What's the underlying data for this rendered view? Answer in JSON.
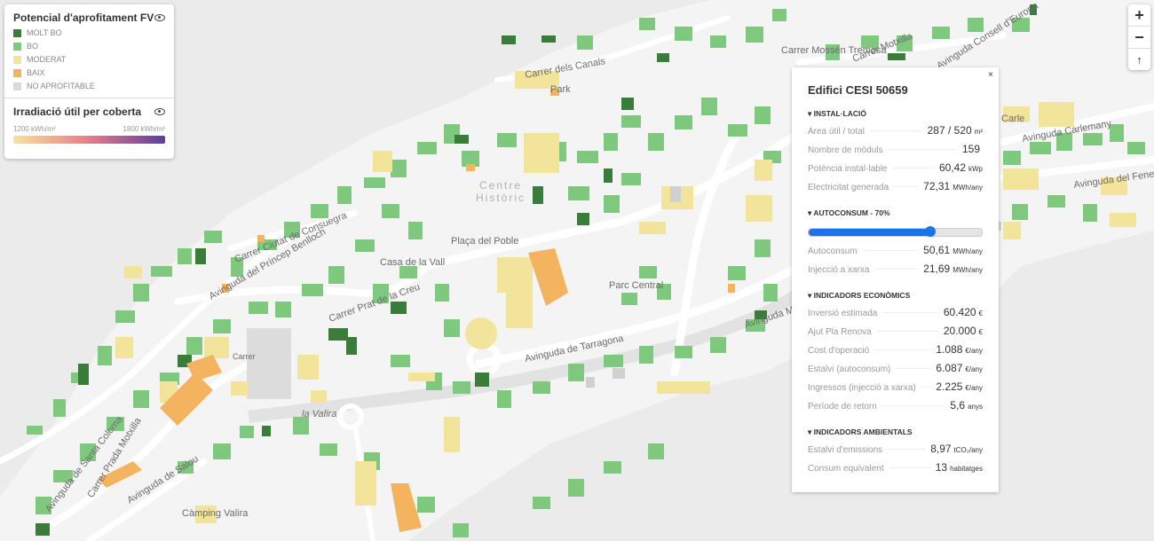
{
  "legend": {
    "title": "Potencial d'aprofitament FV",
    "items": [
      {
        "label": "MOLT BO",
        "color": "#3a7d3a"
      },
      {
        "label": "BO",
        "color": "#7fc97f"
      },
      {
        "label": "MODERAT",
        "color": "#f2e49a"
      },
      {
        "label": "BAIX",
        "color": "#f4b35e"
      },
      {
        "label": "NO APROFITABLE",
        "color": "#dadada"
      }
    ],
    "irradiance": {
      "title": "Irradiació útil per coberta",
      "min_label": "1200 kWh/m²",
      "max_label": "1800 kWh/m²",
      "colors": [
        "#f6e49c",
        "#e77b8a",
        "#5a3f9c"
      ]
    }
  },
  "controls": {
    "zoom_in": "+",
    "zoom_out": "−",
    "compass": "↑"
  },
  "map": {
    "street_labels": [
      {
        "text": "Carrer dels Canals"
      },
      {
        "text": "Park"
      },
      {
        "text": "Centre"
      },
      {
        "text": "Històric"
      },
      {
        "text": "Plaça del Poble"
      },
      {
        "text": "Casa de la Vall"
      },
      {
        "text": "Carrer Prat de la Creu"
      },
      {
        "text": "Avinguda del Príncep Benlloch"
      },
      {
        "text": "Carrer Ciutat de Consuegra"
      },
      {
        "text": "Parc Central"
      },
      {
        "text": "Avinguda de Tarragona"
      },
      {
        "text": "Avinguda Meritxell"
      },
      {
        "text": "la Valira"
      },
      {
        "text": "Avinguda de Salou"
      },
      {
        "text": "Carrer Prada Motxilla"
      },
      {
        "text": "Avinguda de Santa Coloma"
      },
      {
        "text": "Càmping Valira"
      },
      {
        "text": "Carrer Mossèn Tremosa"
      },
      {
        "text": "Avinguda Consell d'Europa"
      },
      {
        "text": "Carrer Motxilla"
      },
      {
        "text": "Avinguda Carlemany"
      },
      {
        "text": "Avinguda del Fener"
      },
      {
        "text": "Carle"
      },
      {
        "text": "Carrer"
      }
    ]
  },
  "panel": {
    "close": "×",
    "title": "Edifici CESI 50659",
    "sections": {
      "installation": {
        "header": "▾ INSTAL·LACIÓ",
        "rows": [
          {
            "label": "Àrea útil / total",
            "value": "287 / 520",
            "unit": "m²"
          },
          {
            "label": "Nombre de mòduls",
            "value": "159",
            "unit": ""
          },
          {
            "label": "Potència instal·lable",
            "value": "60,42",
            "unit": "kWp"
          },
          {
            "label": "Electricitat generada",
            "value": "72,31",
            "unit": "MWh/any"
          }
        ]
      },
      "autoconsum": {
        "header": "▾ AUTOCONSUM - 70%",
        "slider_value": 0.7,
        "rows": [
          {
            "label": "Autoconsum",
            "value": "50,61",
            "unit": "MWh/any"
          },
          {
            "label": "Injecció a xarxa",
            "value": "21,69",
            "unit": "MWh/any"
          }
        ]
      },
      "economic": {
        "header": "▾ INDICADORS ECONÒMICS",
        "rows": [
          {
            "label": "Inversió estimada",
            "value": "60.420",
            "unit": "€"
          },
          {
            "label": "Ajut Pla Renova",
            "value": "20.000",
            "unit": "€"
          },
          {
            "label": "Cost d'operació",
            "value": "1.088",
            "unit": "€/any"
          },
          {
            "label": "Estalvi (autoconsum)",
            "value": "6.087",
            "unit": "€/any"
          },
          {
            "label": "Ingressos (injecció a xarxa)",
            "value": "2.225",
            "unit": "€/any"
          },
          {
            "label": "Període de retorn",
            "value": "5,6",
            "unit": "anys"
          }
        ]
      },
      "environmental": {
        "header": "▾ INDICADORS AMBIENTALS",
        "rows": [
          {
            "label": "Estalvi d'emissions",
            "value": "8,97",
            "unit": "tCO₂/any"
          },
          {
            "label": "Consum equivalent",
            "value": "13",
            "unit": "habitatges"
          }
        ]
      }
    }
  }
}
